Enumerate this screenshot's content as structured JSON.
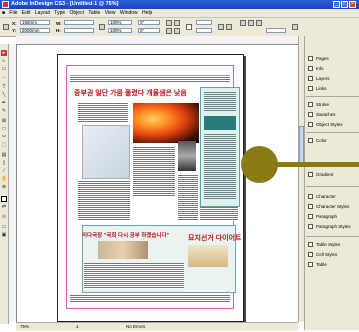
{
  "window": {
    "title": "Adobe InDesign CS3 - [Untitled-1 @ 75%]"
  },
  "menubar": {
    "items": [
      "File",
      "Edit",
      "Layout",
      "Type",
      "Object",
      "Table",
      "View",
      "Window",
      "Help"
    ]
  },
  "controlbar": {
    "x_label": "X:",
    "x_value": "158mm",
    "y_label": "Y:",
    "y_value": "2000mm",
    "w_label": "W:",
    "w_value": "",
    "h_label": "H:",
    "h_value": "",
    "scale_x": "100%",
    "scale_y": "100%",
    "rotate": "0°",
    "shear": "0°"
  },
  "statusbar": {
    "page": "1",
    "zoom": "75%",
    "preflight": "No Errors"
  },
  "panel": {
    "items": [
      "Pages",
      "Info",
      "Layers",
      "Links",
      "Stroke",
      "Swatches",
      "Object Styles",
      "Color",
      "Gradient",
      "Character",
      "Character Styles",
      "Paragraph",
      "Paragraph Styles",
      "Table Styles",
      "Cell Styles",
      "Table"
    ]
  },
  "newspaper": {
    "headline": "중부권 일단 가뭄 풀렸다 개울샘은 낮음",
    "sub_headline": "리다국장 \"국회 다시 공부 하겠습니다\"",
    "feature_headline": "묘지선거 다이어트"
  },
  "colors": {
    "titlebar": "#1b45b8",
    "chrome": "#ece9d8",
    "margin_guide": "#d060c0",
    "headline": "#b01818",
    "knob": "#8a7a16"
  }
}
